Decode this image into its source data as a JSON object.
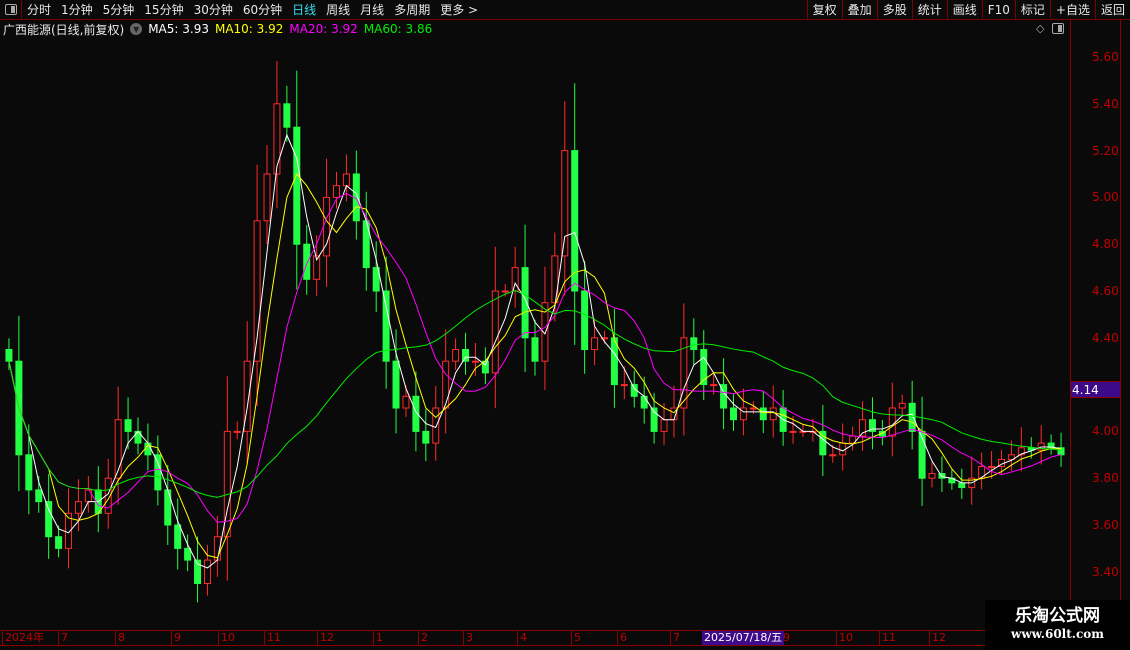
{
  "toolbar": {
    "periods": [
      "分时",
      "1分钟",
      "5分钟",
      "15分钟",
      "30分钟",
      "60分钟",
      "日线",
      "周线",
      "月线",
      "多周期",
      "更多 >"
    ],
    "active_period": "日线",
    "right_buttons": [
      "复权",
      "叠加",
      "多股",
      "统计",
      "画线",
      "F10",
      "标记",
      "+自选",
      "返回"
    ]
  },
  "info": {
    "title": "广西能源(日线,前复权)",
    "ma5": "MA5: 3.93",
    "ma10": "MA10: 3.92",
    "ma20": "MA20: 3.92",
    "ma60": "MA60: 3.86"
  },
  "colors": {
    "up": "#ff2a2a",
    "down": "#00e0e0",
    "down_fill": "#22ff44",
    "ma5": "#ffffff",
    "ma10": "#ffff00",
    "ma20": "#ff00ff",
    "ma60": "#00ee00",
    "axis": "#c00000",
    "tag": "#3d0a8a"
  },
  "current_price": "4.14",
  "x_axis": {
    "labels": [
      "2024年",
      "7",
      "8",
      "9",
      "10",
      "11",
      "12",
      "1",
      "2",
      "3",
      "4",
      "5",
      "6",
      "7",
      "9",
      "10",
      "11",
      "12"
    ],
    "crosshair_date": "2025/07/18/五"
  },
  "watermark": {
    "line1": "乐淘公式网",
    "line2": "www.60lt.com"
  },
  "chart_data": {
    "type": "candlestick",
    "ylim": [
      3.28,
      5.72
    ],
    "yticks": [
      "5.60",
      "5.40",
      "5.20",
      "5.00",
      "4.80",
      "4.60",
      "4.40",
      "4.00",
      "3.80",
      "3.60",
      "3.40"
    ],
    "closes": [
      4.3,
      3.9,
      3.75,
      3.7,
      3.55,
      3.5,
      3.65,
      3.7,
      3.75,
      3.65,
      3.8,
      4.05,
      4.0,
      3.95,
      3.9,
      3.75,
      3.6,
      3.5,
      3.45,
      3.35,
      3.45,
      3.55,
      4.0,
      4.0,
      4.3,
      4.9,
      5.1,
      5.4,
      5.3,
      4.8,
      4.65,
      4.75,
      5.0,
      5.05,
      5.1,
      4.9,
      4.7,
      4.6,
      4.3,
      4.1,
      4.15,
      4.0,
      3.95,
      4.1,
      4.3,
      4.35,
      4.3,
      4.3,
      4.25,
      4.6,
      4.6,
      4.7,
      4.4,
      4.3,
      4.55,
      4.75,
      5.2,
      4.6,
      4.35,
      4.4,
      4.4,
      4.2,
      4.2,
      4.15,
      4.1,
      4.0,
      4.05,
      4.1,
      4.4,
      4.35,
      4.2,
      4.2,
      4.1,
      4.05,
      4.1,
      4.1,
      4.05,
      4.1,
      4.0,
      4.0,
      4.0,
      4.0,
      3.9,
      3.9,
      3.95,
      3.98,
      4.05,
      4.0,
      3.98,
      4.1,
      4.12,
      4.0,
      3.8,
      3.82,
      3.8,
      3.78,
      3.76,
      3.8,
      3.85,
      3.85,
      3.88,
      3.9,
      3.93,
      3.92,
      3.95,
      3.93,
      3.9
    ]
  }
}
